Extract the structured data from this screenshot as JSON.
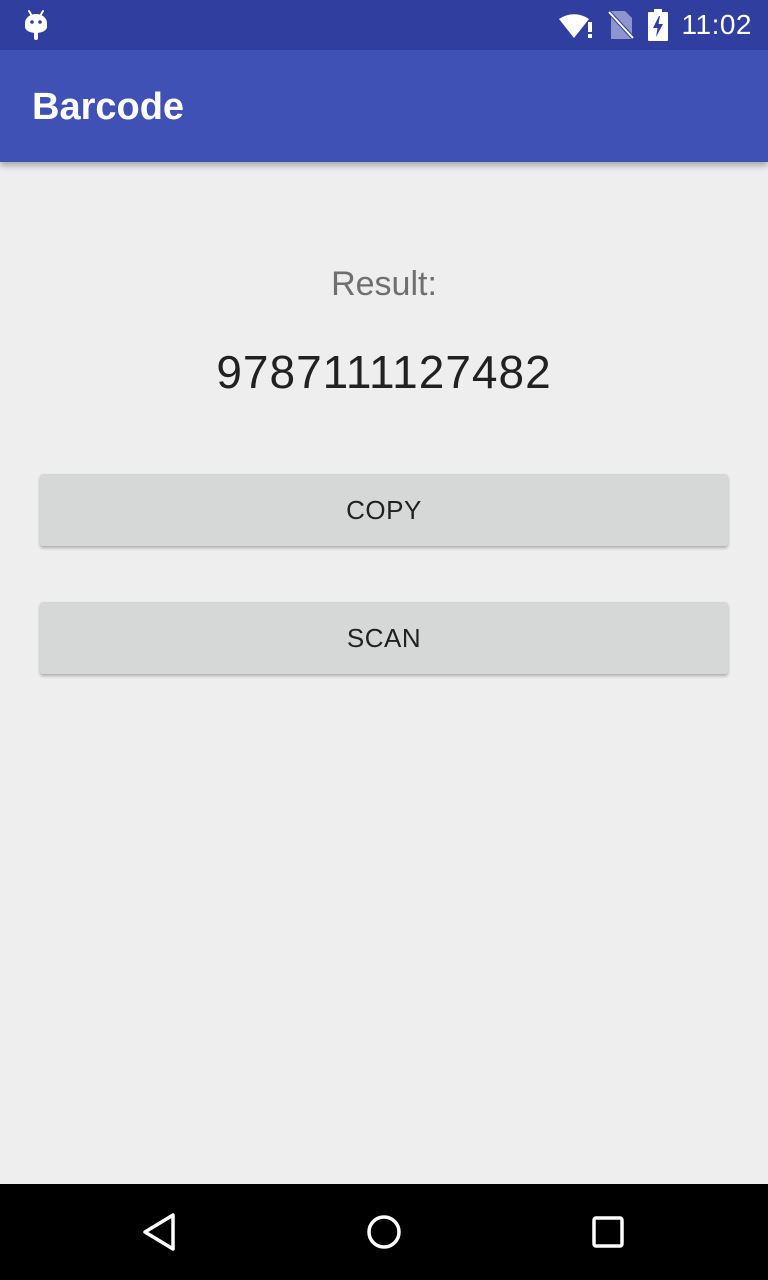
{
  "status_bar": {
    "time": "11:02",
    "icons": [
      "android-debug-icon",
      "wifi-icon",
      "no-sim-icon",
      "battery-charging-icon"
    ]
  },
  "app_bar": {
    "title": "Barcode"
  },
  "main": {
    "result_label": "Result:",
    "result_value": "9787111127482",
    "copy_button": "COPY",
    "scan_button": "SCAN"
  },
  "nav_bar": {
    "icons": [
      "back-icon",
      "home-icon",
      "recents-icon"
    ]
  },
  "colors": {
    "status_bar": "#303f9f",
    "app_bar": "#3f51b5",
    "background": "#eeeeee",
    "button": "#d6d7d7",
    "nav_bar": "#000000"
  }
}
